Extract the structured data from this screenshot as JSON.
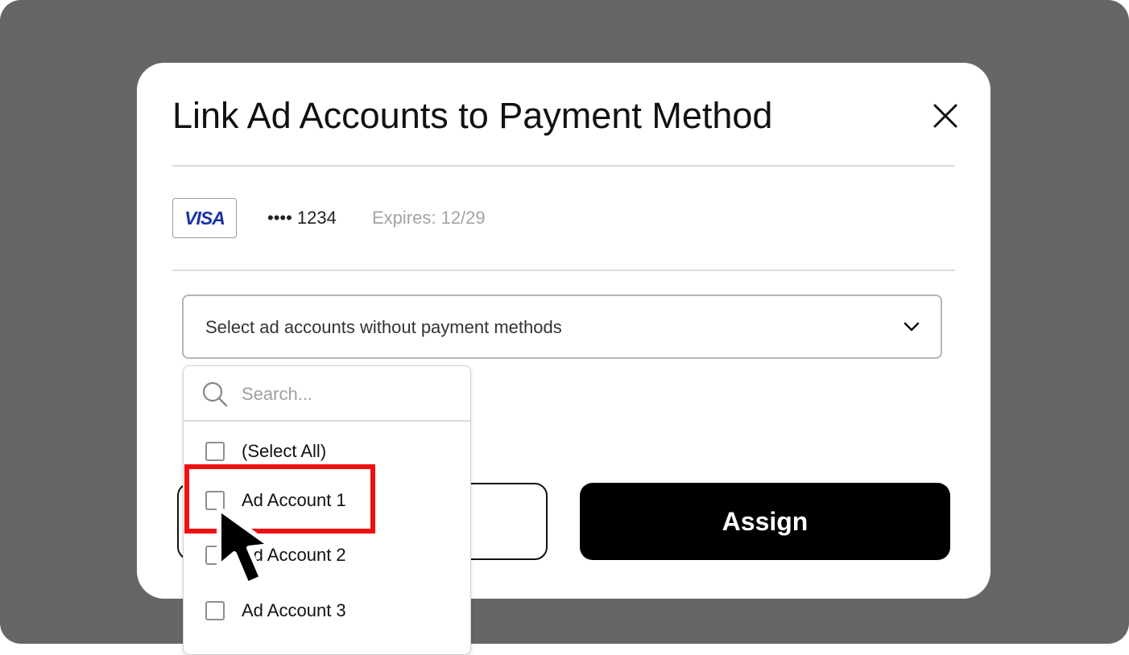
{
  "modal": {
    "title": "Link Ad Accounts to Payment Method",
    "close_icon": "close-icon"
  },
  "payment_method": {
    "brand": "VISA",
    "brand_color": "#1a33a8",
    "masked_number": "•••• 1234",
    "expiry": "Expires: 12/29"
  },
  "select": {
    "placeholder": "Select ad accounts without payment methods",
    "chevron_icon": "chevron-down-icon"
  },
  "dropdown": {
    "search_placeholder": "Search...",
    "search_icon": "search-icon",
    "options": [
      {
        "label": "(Select All)",
        "checked": false
      },
      {
        "label": "Ad Account 1",
        "checked": false
      },
      {
        "label": "Ad Account 2",
        "checked": false
      },
      {
        "label": "Ad Account 3",
        "checked": false
      }
    ]
  },
  "buttons": {
    "assign_label": "Assign"
  },
  "colors": {
    "backdrop": "#666666",
    "highlight": "#ee1111",
    "primary_button": "#000000"
  }
}
